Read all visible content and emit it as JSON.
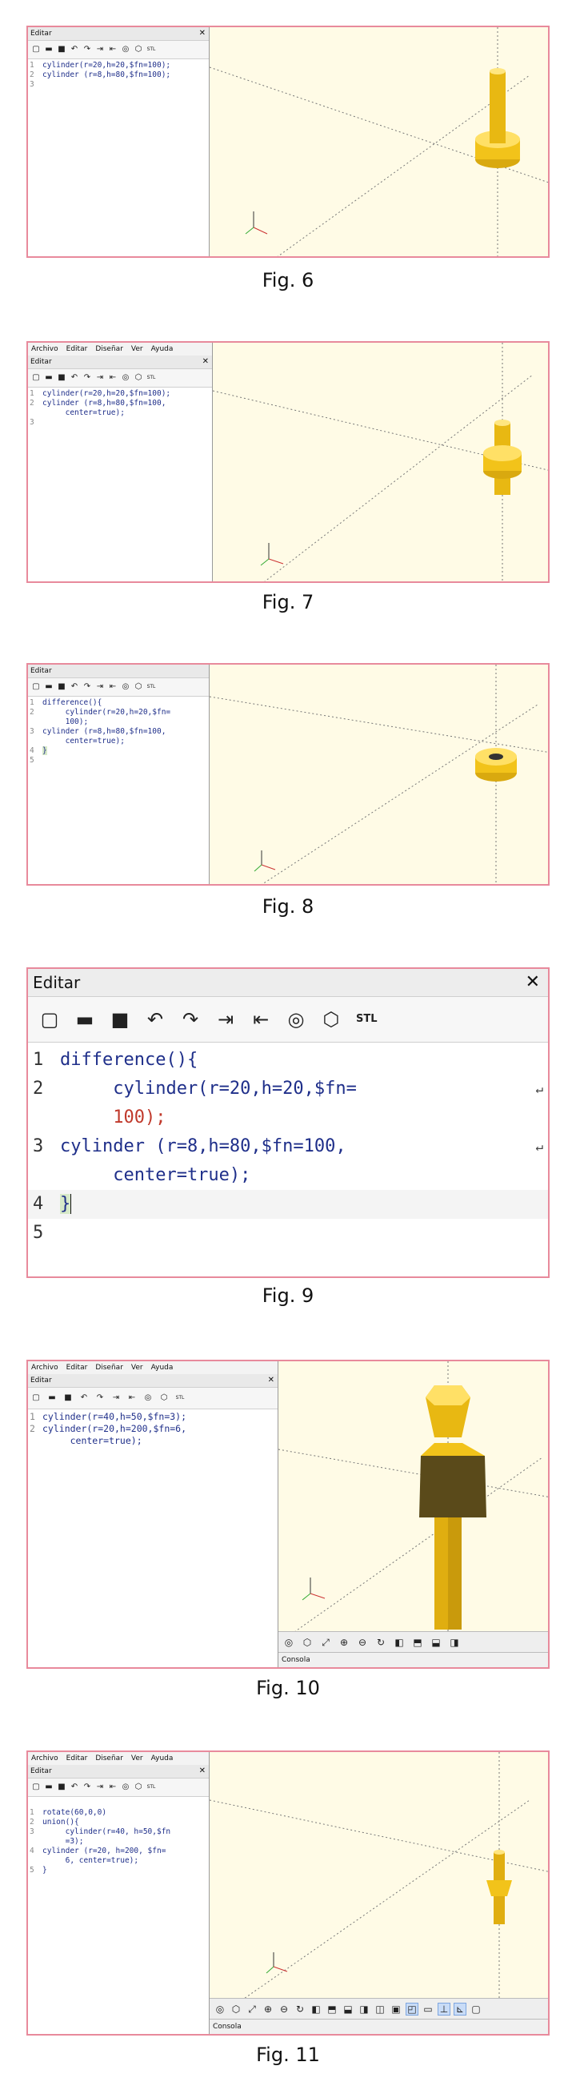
{
  "figures": [
    {
      "caption": "Fig. 6",
      "editor_title": "Editar",
      "code": [
        {
          "n": "1",
          "text": "cylinder(r=20,h=20,$fn=100);"
        },
        {
          "n": "2",
          "text": "cylinder (r=8,h=80,$fn=100);"
        },
        {
          "n": "3",
          "text": ""
        }
      ]
    },
    {
      "caption": "Fig. 7",
      "menu": [
        "Archivo",
        "Editar",
        "Diseñar",
        "Ver",
        "Ayuda"
      ],
      "editor_title": "Editar",
      "code": [
        {
          "n": "1",
          "text": "cylinder(r=20,h=20,$fn=100);"
        },
        {
          "n": "2",
          "text": "cylinder (r=8,h=80,$fn=100,"
        },
        {
          "n": "",
          "text": "     center=true);"
        },
        {
          "n": "3",
          "text": ""
        }
      ]
    },
    {
      "caption": "Fig. 8",
      "editor_title": "Editar",
      "code": [
        {
          "n": "1",
          "text": "difference(){"
        },
        {
          "n": "2",
          "text": "     cylinder(r=20,h=20,$fn="
        },
        {
          "n": "",
          "text": "     100);"
        },
        {
          "n": "3",
          "text": "cylinder (r=8,h=80,$fn=100,"
        },
        {
          "n": "",
          "text": "     center=true);"
        },
        {
          "n": "4",
          "text": "}"
        },
        {
          "n": "5",
          "text": ""
        }
      ]
    },
    {
      "caption": "Fig. 9",
      "editor_title": "Editar",
      "code": [
        {
          "n": "1",
          "text": "difference(){"
        },
        {
          "n": "2",
          "text": "     cylinder(r=20,h=20,$fn="
        },
        {
          "n": "",
          "text": "     100);"
        },
        {
          "n": "3",
          "text": "cylinder (r=8,h=80,$fn=100,"
        },
        {
          "n": "",
          "text": "     center=true);"
        },
        {
          "n": "4",
          "text": "}"
        },
        {
          "n": "5",
          "text": ""
        }
      ]
    },
    {
      "caption": "Fig. 10",
      "menu": [
        "Archivo",
        "Editar",
        "Diseñar",
        "Ver",
        "Ayuda"
      ],
      "editor_title": "Editar",
      "console": "Consola",
      "code": [
        {
          "n": "1",
          "text": "cylinder(r=40,h=50,$fn=3);"
        },
        {
          "n": "2",
          "text": "cylinder(r=20,h=200,$fn=6,"
        },
        {
          "n": "",
          "text": "     center=true);"
        }
      ]
    },
    {
      "caption": "Fig. 11",
      "menu": [
        "Archivo",
        "Editar",
        "Diseñar",
        "Ver",
        "Ayuda"
      ],
      "editor_title": "Editar",
      "console": "Consola",
      "code": [
        {
          "n": "1",
          "text": "rotate(60,0,0)"
        },
        {
          "n": "2",
          "text": "union(){"
        },
        {
          "n": "3",
          "text": "     cylinder(r=40, h=50,$fn"
        },
        {
          "n": "",
          "text": "     =3);"
        },
        {
          "n": "4",
          "text": "cylinder (r=20, h=200, $fn="
        },
        {
          "n": "",
          "text": "     6, center=true);"
        },
        {
          "n": "5",
          "text": "}"
        }
      ]
    }
  ],
  "toolbar_icons": [
    "new-file-icon",
    "open-folder-icon",
    "save-icon",
    "undo-icon",
    "redo-icon",
    "indent-icon",
    "unindent-icon",
    "preview-icon",
    "render-icon",
    "export-stl-icon"
  ],
  "toolbar_stl_label": "STL",
  "colors": {
    "border": "#e88a9c",
    "viewport": "#fffbe6",
    "model_yellow": "#f2c31a",
    "code_blue": "#1f2f8a",
    "number_red": "#c0392b",
    "bool_green": "#1a7a1a"
  }
}
